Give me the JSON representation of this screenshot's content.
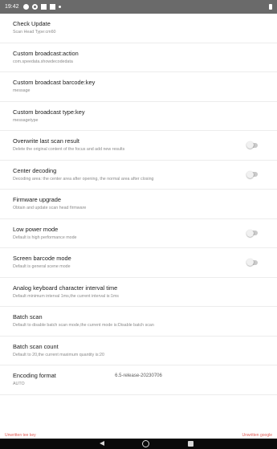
{
  "status_bar": {
    "time": "19:42",
    "icons": [
      "p-icon",
      "gear-icon",
      "square-icon",
      "square-icon",
      "dot-icon"
    ],
    "battery_icon": "battery-icon"
  },
  "settings": [
    {
      "id": "check-update",
      "title": "Check Update",
      "summary": "Scan Head Type:cm60",
      "toggle": false
    },
    {
      "id": "custom-broadcast-action",
      "title": "Custom broadcast:action",
      "summary": "com.speedata.showdecodedata",
      "toggle": false
    },
    {
      "id": "custom-broadcast-barcode-key",
      "title": "Custom broadcast barcode:key",
      "summary": "message",
      "toggle": false
    },
    {
      "id": "custom-broadcast-type-key",
      "title": "Custom broadcast type:key",
      "summary": "messagetype",
      "toggle": false
    },
    {
      "id": "overwrite-last-scan-result",
      "title": "Overwrite last scan result",
      "summary": "Delete the original content of the focus and add new results",
      "toggle": true,
      "checked": false
    },
    {
      "id": "center-decoding",
      "title": "Center decoding",
      "summary": "Decoding area: the center area after opening, the normal area after closing",
      "toggle": true,
      "checked": false
    },
    {
      "id": "firmware-upgrade",
      "title": "Firmware upgrade",
      "summary": "Obtain and update scan head firmware",
      "toggle": false
    },
    {
      "id": "low-power-mode",
      "title": "Low power mode",
      "summary": "Default is high performance mode",
      "toggle": true,
      "checked": false
    },
    {
      "id": "screen-barcode-mode",
      "title": "Screen barcode mode",
      "summary": "Default is general scene mode",
      "toggle": true,
      "checked": false
    },
    {
      "id": "analog-keyboard-interval",
      "title": "Analog keyboard character interval time",
      "summary": "Default minimum interval 1ms,the current interval is:1ms",
      "toggle": false
    },
    {
      "id": "batch-scan",
      "title": "Batch scan",
      "summary": "Default to disable batch scan mode,the current mode is:Disable batch scan",
      "toggle": false
    },
    {
      "id": "batch-scan-count",
      "title": "Batch scan count",
      "summary": "Default to 20,the current maximum quantity is:20",
      "toggle": false
    },
    {
      "id": "encoding-format",
      "title": "Encoding format",
      "summary": "AUTO",
      "toggle": false
    }
  ],
  "version": "6.5-release-20230706",
  "watermarks": {
    "left": "Unwritten tee key",
    "right": "Unwritten google"
  },
  "nav_bar": {
    "back_icon": "back-icon",
    "home_icon": "home-icon",
    "recents_icon": "recents-icon"
  }
}
